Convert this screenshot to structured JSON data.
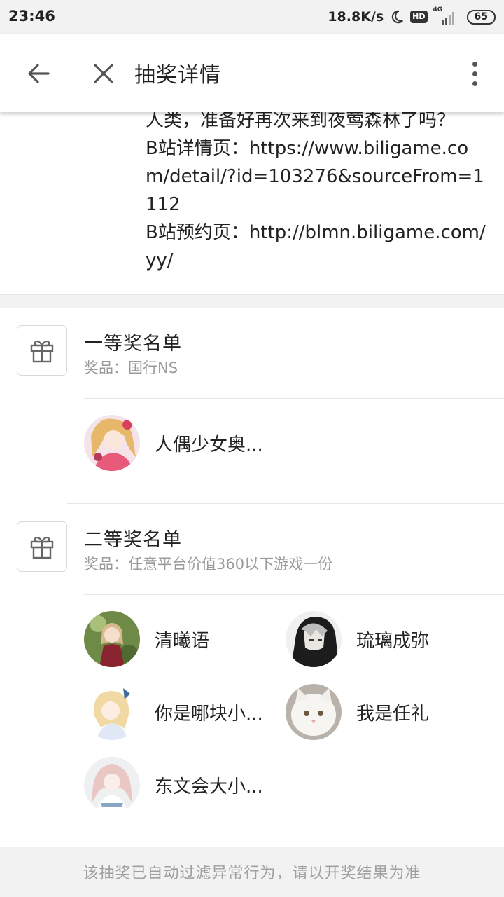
{
  "status_bar": {
    "time": "23:46",
    "net_speed": "18.8K/s",
    "hd_label": "HD",
    "signal_label": "4G",
    "battery": "65"
  },
  "header": {
    "title": "抽奖详情"
  },
  "description": {
    "lines": [
      "人类，准备好再次来到夜莺森林了吗？",
      "B站详情页：https://www.biligame.com/detail/?id=103276&sourceFrom=1112",
      "B站预约页：http://blmn.biligame.com/yy/"
    ]
  },
  "prizes": [
    {
      "title": "一等奖名单",
      "subtitle": "奖品：国行NS",
      "winners": [
        {
          "name": "人偶少女奥..."
        }
      ]
    },
    {
      "title": "二等奖名单",
      "subtitle": "奖品：任意平台价值360以下游戏一份",
      "winners": [
        {
          "name": "清曦语"
        },
        {
          "name": "琉璃成弥"
        },
        {
          "name": "你是哪块小..."
        },
        {
          "name": "我是任礼"
        },
        {
          "name": "东文会大小..."
        }
      ]
    }
  ],
  "footer": {
    "note": "该抽奖已自动过滤异常行为，请以开奖结果为准"
  },
  "icons": {
    "back": "arrow-left-icon",
    "close": "close-icon",
    "more": "more-vertical-icon",
    "gift": "gift-icon"
  }
}
